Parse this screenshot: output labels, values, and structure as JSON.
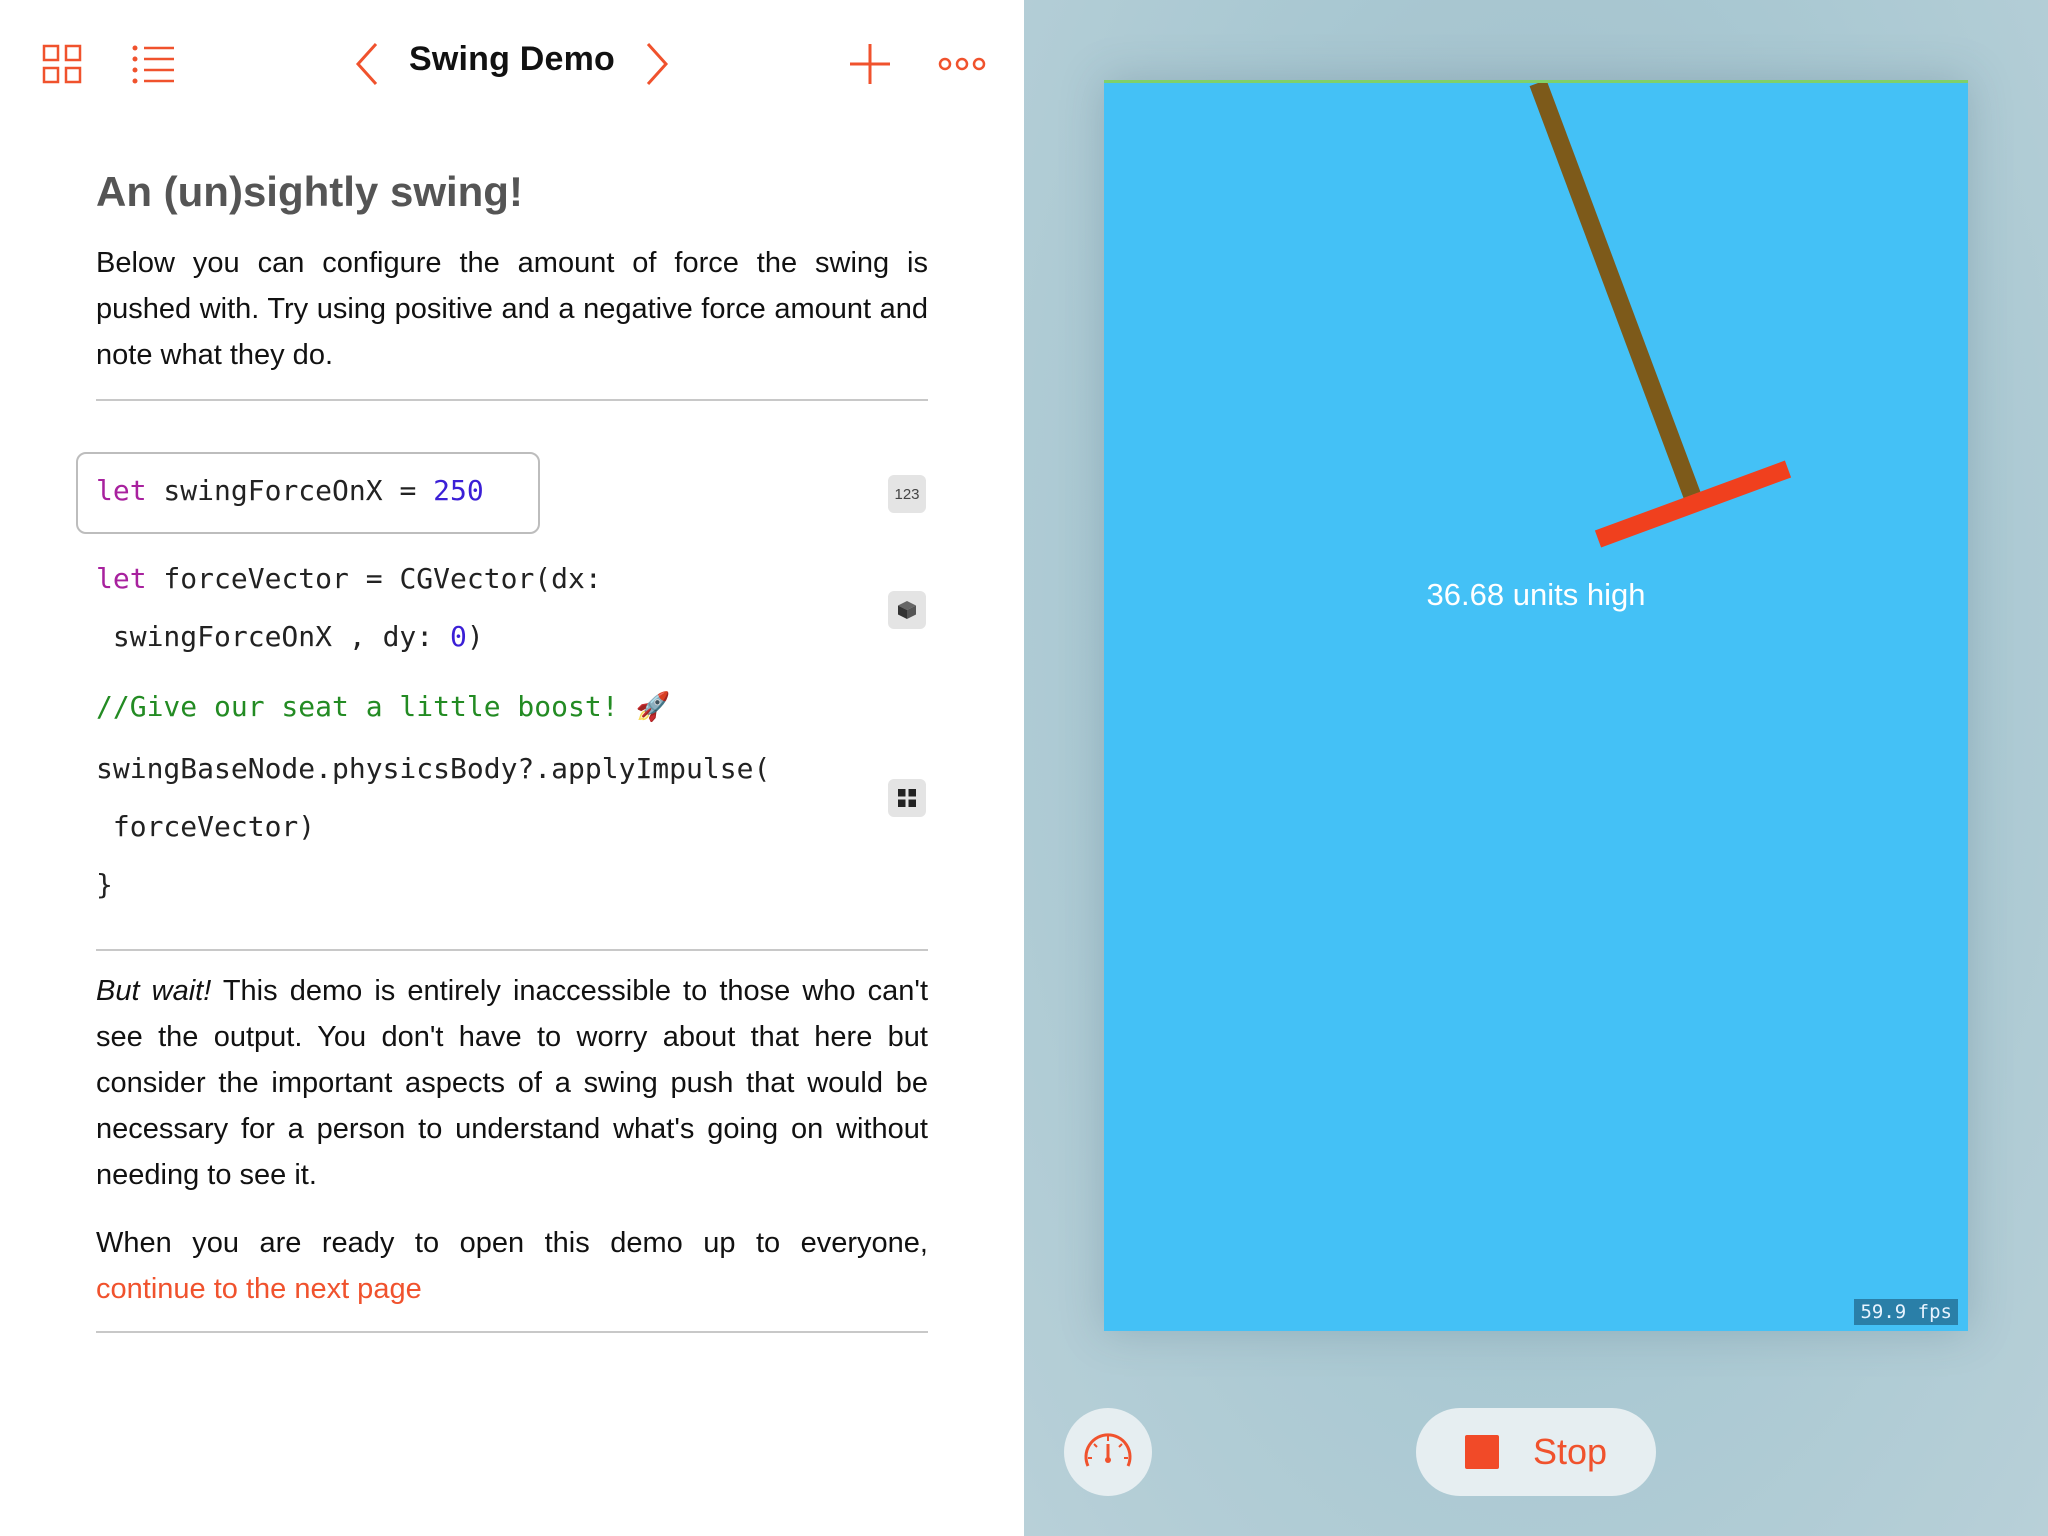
{
  "toolbar": {
    "title": "Swing Demo",
    "icons": [
      "grid-icon",
      "list-icon",
      "chevron-left-icon",
      "chevron-right-icon",
      "plus-icon",
      "more-icon"
    ]
  },
  "heading": "An (un)sightly swing!",
  "intro": "Below you can configure the amount of force the swing is pushed with. Try using positive and a negative force amount and note what they do.",
  "code": {
    "line1_kw": "let",
    "line1_name": " swingForceOnX = ",
    "line1_value": "250",
    "line1_badge": "123",
    "line2_kw": "let",
    "line2_text": " forceVector = CGVector(dx:",
    "line3_text": " swingForceOnX , dy: ",
    "line3_value": "0",
    "line3_close": ")",
    "comment": "//Give our seat a little boost! 🚀",
    "line5_text": "swingBaseNode.physicsBody?.applyImpulse(",
    "line6_text": " forceVector)",
    "line7_text": "}"
  },
  "body": {
    "emphasis": "But wait!",
    "paragraph1_rest": " This demo is entirely inaccessible to those who can't see the output. You don't have to worry about that here but consider the important aspects of a swing push that would be necessary for a person to understand what's going on without needing to see it.",
    "paragraph2": "When you are ready to open this demo up to everyone,",
    "link": "continue to the next page"
  },
  "scene": {
    "height_label": "36.68 units high",
    "fps": "59.9 fps",
    "colors": {
      "background": "#44c1f6",
      "rope": "#7d5a1a",
      "seat": "#f0401e"
    }
  },
  "controls": {
    "stop_label": "Stop",
    "gauge_icon": "speedometer-icon",
    "stop_icon": "stop-square-icon"
  },
  "colors": {
    "accent": "#f0522d"
  }
}
